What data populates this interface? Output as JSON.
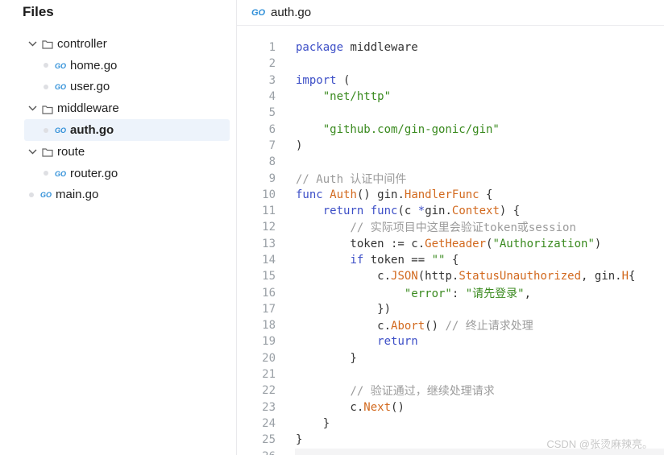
{
  "sidebar": {
    "title": "Files",
    "items": [
      {
        "label": "controller",
        "type": "folder",
        "expanded": true,
        "depth": 0
      },
      {
        "label": "home.go",
        "type": "file",
        "depth": 1
      },
      {
        "label": "user.go",
        "type": "file",
        "depth": 1
      },
      {
        "label": "middleware",
        "type": "folder",
        "expanded": true,
        "depth": 0
      },
      {
        "label": "auth.go",
        "type": "file",
        "depth": 1,
        "selected": true
      },
      {
        "label": "route",
        "type": "folder",
        "expanded": true,
        "depth": 0
      },
      {
        "label": "router.go",
        "type": "file",
        "depth": 1
      },
      {
        "label": "main.go",
        "type": "file",
        "depth": 0
      }
    ]
  },
  "editor": {
    "tab_title": "auth.go",
    "line_numbers": [
      "1",
      "2",
      "3",
      "4",
      "5",
      "6",
      "7",
      "8",
      "9",
      "10",
      "11",
      "12",
      "13",
      "14",
      "15",
      "16",
      "17",
      "18",
      "19",
      "20",
      "21",
      "22",
      "23",
      "24",
      "25",
      "26"
    ],
    "lines": [
      [
        {
          "t": "package",
          "c": "kw"
        },
        {
          "t": " middleware",
          "c": ""
        }
      ],
      [],
      [
        {
          "t": "import",
          "c": "kw"
        },
        {
          "t": " (",
          "c": ""
        }
      ],
      [
        {
          "t": "    ",
          "c": ""
        },
        {
          "t": "\"net/http\"",
          "c": "str"
        }
      ],
      [],
      [
        {
          "t": "    ",
          "c": ""
        },
        {
          "t": "\"github.com/gin-gonic/gin\"",
          "c": "str"
        }
      ],
      [
        {
          "t": ")",
          "c": ""
        }
      ],
      [],
      [
        {
          "t": "// Auth 认证中间件",
          "c": "cm"
        }
      ],
      [
        {
          "t": "func",
          "c": "kw"
        },
        {
          "t": " ",
          "c": ""
        },
        {
          "t": "Auth",
          "c": "fn"
        },
        {
          "t": "() gin.",
          "c": ""
        },
        {
          "t": "HandlerFunc",
          "c": "fn"
        },
        {
          "t": " {",
          "c": ""
        }
      ],
      [
        {
          "t": "    ",
          "c": ""
        },
        {
          "t": "return",
          "c": "kw"
        },
        {
          "t": " ",
          "c": ""
        },
        {
          "t": "func",
          "c": "kw"
        },
        {
          "t": "(c ",
          "c": ""
        },
        {
          "t": "*",
          "c": "kw"
        },
        {
          "t": "gin.",
          "c": ""
        },
        {
          "t": "Context",
          "c": "fn"
        },
        {
          "t": ") {",
          "c": ""
        }
      ],
      [
        {
          "t": "        ",
          "c": ""
        },
        {
          "t": "// 实际项目中这里会验证token或session",
          "c": "cm"
        }
      ],
      [
        {
          "t": "        token := c.",
          "c": ""
        },
        {
          "t": "GetHeader",
          "c": "fn"
        },
        {
          "t": "(",
          "c": ""
        },
        {
          "t": "\"Authorization\"",
          "c": "str"
        },
        {
          "t": ")",
          "c": ""
        }
      ],
      [
        {
          "t": "        ",
          "c": ""
        },
        {
          "t": "if",
          "c": "kw"
        },
        {
          "t": " token == ",
          "c": ""
        },
        {
          "t": "\"\"",
          "c": "str"
        },
        {
          "t": " {",
          "c": ""
        }
      ],
      [
        {
          "t": "            c.",
          "c": ""
        },
        {
          "t": "JSON",
          "c": "fn"
        },
        {
          "t": "(http.",
          "c": ""
        },
        {
          "t": "StatusUnauthorized",
          "c": "fn"
        },
        {
          "t": ", gin.",
          "c": ""
        },
        {
          "t": "H",
          "c": "fn"
        },
        {
          "t": "{",
          "c": ""
        }
      ],
      [
        {
          "t": "                ",
          "c": ""
        },
        {
          "t": "\"error\"",
          "c": "str"
        },
        {
          "t": ": ",
          "c": ""
        },
        {
          "t": "\"请先登录\"",
          "c": "str"
        },
        {
          "t": ",",
          "c": ""
        }
      ],
      [
        {
          "t": "            })",
          "c": ""
        }
      ],
      [
        {
          "t": "            c.",
          "c": ""
        },
        {
          "t": "Abort",
          "c": "fn"
        },
        {
          "t": "() ",
          "c": ""
        },
        {
          "t": "// 终止请求处理",
          "c": "cm"
        }
      ],
      [
        {
          "t": "            ",
          "c": ""
        },
        {
          "t": "return",
          "c": "kw"
        }
      ],
      [
        {
          "t": "        }",
          "c": ""
        }
      ],
      [],
      [
        {
          "t": "        ",
          "c": ""
        },
        {
          "t": "// 验证通过，继续处理请求",
          "c": "cm"
        }
      ],
      [
        {
          "t": "        c.",
          "c": ""
        },
        {
          "t": "Next",
          "c": "fn"
        },
        {
          "t": "()",
          "c": ""
        }
      ],
      [
        {
          "t": "    }",
          "c": ""
        }
      ],
      [
        {
          "t": "}",
          "c": ""
        }
      ],
      []
    ]
  },
  "watermark": "CSDN @张烫麻辣亮。",
  "colors": {
    "keyword": "#3d4fc7",
    "string": "#3a8a1f",
    "function": "#d2691e",
    "comment": "#9b9b9b",
    "go_icon": "#2f8fd8",
    "selected_bg": "#edf3fb"
  },
  "icons": {
    "folder": "folder-icon",
    "go_file": "go-file-icon",
    "chevron": "chevron-down-icon"
  }
}
